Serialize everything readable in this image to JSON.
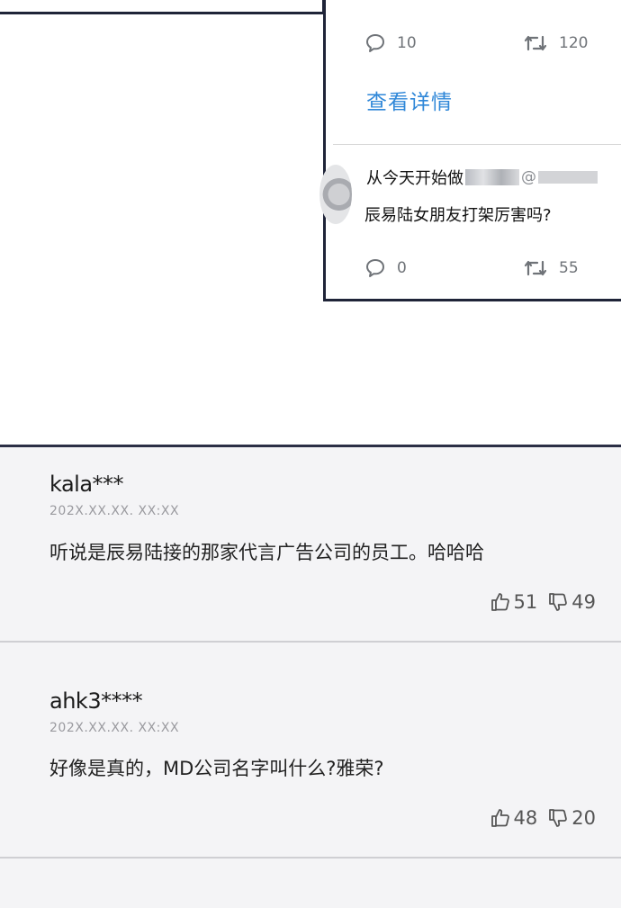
{
  "tweet1": {
    "reply_count": "10",
    "retweet_count": "120",
    "detail_link": "查看详情"
  },
  "tweet2": {
    "author": "从今天开始做",
    "handle": "@",
    "text": "辰易陆女朋友打架厉害吗?",
    "reply_count": "0",
    "retweet_count": "55"
  },
  "comments": [
    {
      "user": "kala***",
      "date": "202X.XX.XX. XX:XX",
      "text": "听说是辰易陆接的那家代言广告公司的员工。哈哈哈",
      "likes": "51",
      "dislikes": "49"
    },
    {
      "user": "ahk3****",
      "date": "202X.XX.XX. XX:XX",
      "text": "好像是真的，MD公司名字叫什么?雅荣?",
      "likes": "48",
      "dislikes": "20"
    }
  ],
  "colors": {
    "link": "#2f87d8",
    "frame": "#1f2438",
    "comment_bg": "#f4f4f6"
  }
}
